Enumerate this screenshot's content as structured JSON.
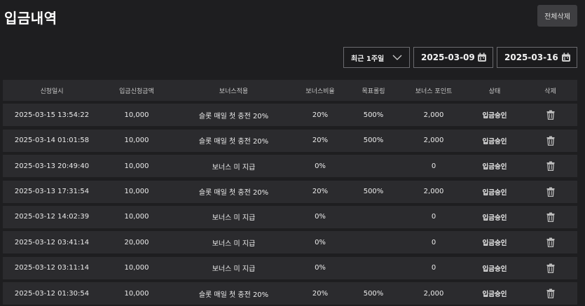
{
  "page": {
    "title": "입금내역",
    "delete_all_label": "전체삭제"
  },
  "filters": {
    "period": "최근 1주일",
    "start_date": "2025-03-09",
    "end_date": "2025-03-16"
  },
  "table": {
    "headers": [
      "신청일시",
      "입금신청금액",
      "보너스적용",
      "보너스비율",
      "목표롤링",
      "보너스 포인트",
      "상태",
      "삭제"
    ],
    "rows": [
      {
        "datetime": "2025-03-15 13:54:22",
        "amount": "10,000",
        "bonus": "슬롯 매일 첫 충전 20%",
        "ratio": "20%",
        "rolling": "500%",
        "points": "2,000",
        "status": "입금승인"
      },
      {
        "datetime": "2025-03-14 01:01:58",
        "amount": "10,000",
        "bonus": "슬롯 매일 첫 충전 20%",
        "ratio": "20%",
        "rolling": "500%",
        "points": "2,000",
        "status": "입금승인"
      },
      {
        "datetime": "2025-03-13 20:49:40",
        "amount": "10,000",
        "bonus": "보너스 미 지급",
        "ratio": "0%",
        "rolling": "",
        "points": "0",
        "status": "입금승인"
      },
      {
        "datetime": "2025-03-13 17:31:54",
        "amount": "10,000",
        "bonus": "슬롯 매일 첫 충전 20%",
        "ratio": "20%",
        "rolling": "500%",
        "points": "2,000",
        "status": "입금승인"
      },
      {
        "datetime": "2025-03-12 14:02:39",
        "amount": "10,000",
        "bonus": "보너스 미 지급",
        "ratio": "0%",
        "rolling": "",
        "points": "0",
        "status": "입금승인"
      },
      {
        "datetime": "2025-03-12 03:41:14",
        "amount": "20,000",
        "bonus": "보너스 미 지급",
        "ratio": "0%",
        "rolling": "",
        "points": "0",
        "status": "입금승인"
      },
      {
        "datetime": "2025-03-12 03:11:14",
        "amount": "10,000",
        "bonus": "보너스 미 지급",
        "ratio": "0%",
        "rolling": "",
        "points": "0",
        "status": "입금승인"
      },
      {
        "datetime": "2025-03-12 01:30:54",
        "amount": "10,000",
        "bonus": "슬롯 매일 첫 충전 20%",
        "ratio": "20%",
        "rolling": "500%",
        "points": "2,000",
        "status": "입금승인"
      }
    ]
  },
  "icons": {
    "delete": "trash-icon",
    "calendar": "calendar-icon",
    "dropdown": "chevron-down-icon"
  }
}
